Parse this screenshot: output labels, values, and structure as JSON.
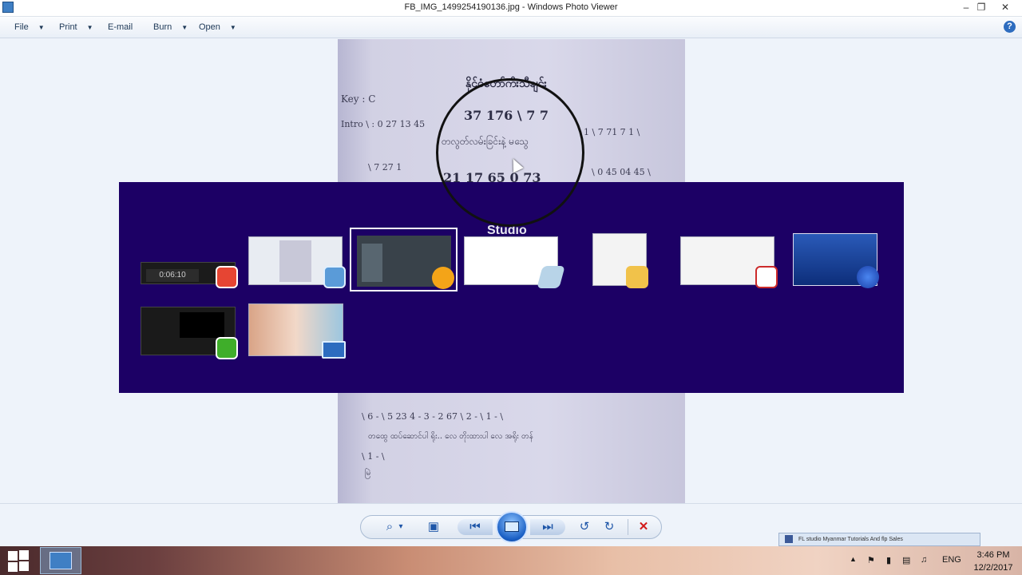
{
  "window": {
    "title": "FB_IMG_1499254190136.jpg - Windows Photo Viewer",
    "minimize_glyph": "–",
    "maximize_glyph": "❐",
    "close_glyph": "✕"
  },
  "menu": {
    "items": [
      {
        "label": "File",
        "has_dropdown": true
      },
      {
        "label": "Print",
        "has_dropdown": true
      },
      {
        "label": "E-mail",
        "has_dropdown": false
      },
      {
        "label": "Burn",
        "has_dropdown": true
      },
      {
        "label": "Open",
        "has_dropdown": true
      }
    ],
    "help_glyph": "?"
  },
  "photo": {
    "title_line": "နိုင်ငံတော်ကီးသီချင်း",
    "key": "Key : C",
    "intro": "Intro \\ : 0  27  13  45",
    "row1_numbers": "37  176  \\  7  7",
    "row1_right": "1 \\ 7   71  7   1 \\",
    "row1_lyric": "တလွတ်လမ်းခြင်းနဲ့     မသွေ",
    "row2_left": "\\ 7  27  1",
    "row2_numbers": "21  17  65  0  73",
    "row2_right": "\\ 0  45  04  45 \\",
    "lower_row1": "\\ 6  -  \\ 5  23  4  -  3  -  2  67 \\ 2  -  \\ 1  -  \\",
    "lower_lyric1": "တထွေ     ထပ်ဆောင်ပါ ရိုး..    လေ     တိုးထားပါ     လေ     အရိုး     တန်",
    "lower_row2": "\\ 1   -  \\",
    "lower_lyric2": "မြဲ"
  },
  "switcher": {
    "peek_label": "Studio",
    "timer_text": "0:06:10"
  },
  "toolbar": {
    "zoom_icon": "⌕",
    "zoom_caret": "▾",
    "actual_size_icon": "▣",
    "prev_icon": "⏮",
    "next_icon": "⏭",
    "rotate_ccw_icon": "↺",
    "rotate_cw_icon": "↻",
    "delete_icon": "✕"
  },
  "taskbar": {
    "notification": "FL studio Myanmar Tutorials And flp Sales",
    "language": "ENG",
    "time": "3:46 PM",
    "date": "12/2/2017",
    "tray_up": "▲",
    "tray_flag": "⚑",
    "tray_power": "▮",
    "tray_network": "▤",
    "tray_volume": "♫"
  },
  "colors": {
    "switcher_bg": "#1c0065",
    "selected_border": "#ffffff",
    "delete_red": "#d21a1a",
    "camtasia_red": "#e64533",
    "camtasia_green": "#3fae2a"
  }
}
